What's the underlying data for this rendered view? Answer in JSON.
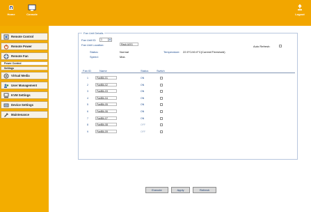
{
  "topbar": {
    "home_label": "Home",
    "console_label": "Console",
    "logout_label": "Logout"
  },
  "sidebar": {
    "items": [
      {
        "label": "Remote Control",
        "icon": "remote-control-icon"
      },
      {
        "label": "Remote Power",
        "icon": "power-icon"
      },
      {
        "label": "Remote Fan",
        "icon": "fan-icon"
      },
      {
        "label": "Power Control"
      },
      {
        "label": "Settings"
      },
      {
        "label": "Virtual Media",
        "icon": "disk-icon"
      },
      {
        "label": "User Management",
        "icon": "users-icon"
      },
      {
        "label": "KVM Settings",
        "icon": "kvm-icon"
      },
      {
        "label": "Device Settings",
        "icon": "device-icon"
      },
      {
        "label": "Maintenance",
        "icon": "wrench-icon"
      }
    ]
  },
  "panel": {
    "legend": "Fan Unit Details",
    "fan_unit_id_label": "Fan Unit ID:",
    "fan_unit_id_value": "1",
    "fan_unit_location_label": "Fan Unit Location:",
    "fan_unit_location_value": "Rack A/0/1",
    "auto_refresh_label": "Auto Refresh:",
    "status_label": "Status:",
    "status_value": "Normal",
    "speed_label": "Speed:",
    "speed_value": "Max.",
    "temperature_label": "Temperature:",
    "temperature_value": "22.5°C/40.0°C(Current/Threshold)"
  },
  "table": {
    "headers": [
      "Fan ID",
      "Name",
      "Status",
      "Switch"
    ],
    "rows": [
      {
        "id": "1",
        "name": "FanBlk-01",
        "status": "ON"
      },
      {
        "id": "2",
        "name": "FanBlk-02",
        "status": "ON"
      },
      {
        "id": "3",
        "name": "FanBlk-03",
        "status": "ON"
      },
      {
        "id": "4",
        "name": "FanBlk-04",
        "status": "ON"
      },
      {
        "id": "5",
        "name": "FanBlk-05",
        "status": "ON"
      },
      {
        "id": "6",
        "name": "FanBlk-06",
        "status": "ON"
      },
      {
        "id": "7",
        "name": "FanBlk-07",
        "status": "ON"
      },
      {
        "id": "8",
        "name": "FanBlk-08",
        "status": "OFF"
      },
      {
        "id": "9",
        "name": "FanBlk-09",
        "status": "OFF"
      }
    ]
  },
  "buttons": {
    "execute": "Execute",
    "apply": "Apply",
    "refresh": "Refresh"
  },
  "colors": {
    "accent": "#f3ad00",
    "link": "#224f90"
  }
}
